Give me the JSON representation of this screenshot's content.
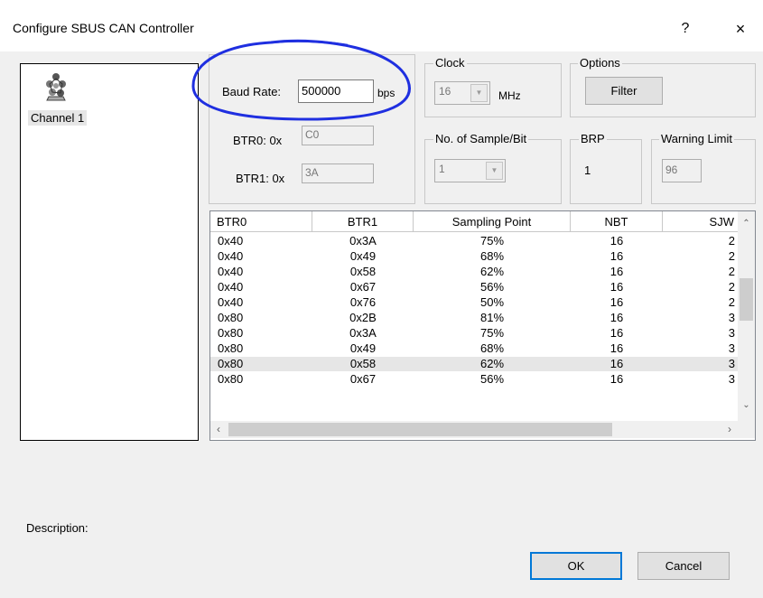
{
  "window": {
    "title": "Configure SBUS CAN Controller",
    "help_label": "?",
    "close_label": "×"
  },
  "channels": [
    {
      "label": "Channel 1"
    }
  ],
  "baud": {
    "label": "Baud Rate:",
    "value": "500000",
    "unit": "bps"
  },
  "btr0": {
    "label": "BTR0: 0x",
    "value": "C0"
  },
  "btr1": {
    "label": "BTR1: 0x",
    "value": "3A"
  },
  "clock": {
    "title": "Clock",
    "value": "16",
    "unit": "MHz"
  },
  "options": {
    "title": "Options",
    "filter_label": "Filter"
  },
  "samples": {
    "title": "No. of Sample/Bit",
    "value": "1"
  },
  "brp": {
    "title": "BRP",
    "value": "1"
  },
  "warning": {
    "title": "Warning Limit",
    "value": "96"
  },
  "table": {
    "headers": [
      "BTR0",
      "BTR1",
      "Sampling Point",
      "NBT",
      "SJW"
    ],
    "rows": [
      [
        "0x40",
        "0x3A",
        "75%",
        "16",
        "2"
      ],
      [
        "0x40",
        "0x49",
        "68%",
        "16",
        "2"
      ],
      [
        "0x40",
        "0x58",
        "62%",
        "16",
        "2"
      ],
      [
        "0x40",
        "0x67",
        "56%",
        "16",
        "2"
      ],
      [
        "0x40",
        "0x76",
        "50%",
        "16",
        "2"
      ],
      [
        "0x80",
        "0x2B",
        "81%",
        "16",
        "3"
      ],
      [
        "0x80",
        "0x3A",
        "75%",
        "16",
        "3"
      ],
      [
        "0x80",
        "0x49",
        "68%",
        "16",
        "3"
      ],
      [
        "0x80",
        "0x58",
        "62%",
        "16",
        "3"
      ],
      [
        "0x80",
        "0x67",
        "56%",
        "16",
        "3"
      ]
    ],
    "selected_row": 8
  },
  "description_label": "Description:",
  "buttons": {
    "ok": "OK",
    "cancel": "Cancel"
  },
  "icons": {
    "channel": "network-node-icon",
    "highlight": "blue-annotation-ellipse"
  },
  "colors": {
    "annotation": "#1f2fe0",
    "selection": "#e6e6e6",
    "default_button_border": "#0078d7"
  }
}
